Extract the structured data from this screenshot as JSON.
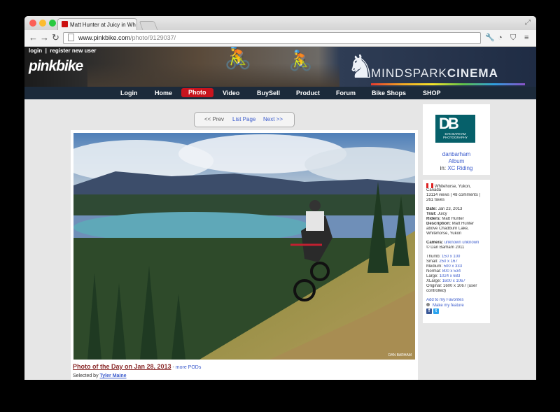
{
  "browser": {
    "tab_title": "Matt Hunter at Juicy in Wh",
    "url_host": "www.pinkbike.com",
    "url_path": "/photo/9129037/",
    "back_glyph": "←",
    "forward_glyph": "→",
    "reload_glyph": "↻",
    "resize_glyph": "⤢",
    "wrench_glyph": "🔧",
    "clock_glyph": "◔",
    "pocket_glyph": "⛉",
    "menu_glyph": "≡"
  },
  "header": {
    "login": "login",
    "separator": "|",
    "register": "register new user",
    "logo_text": "pinkbike",
    "banner_thin": "MINDSPARK",
    "banner_bold": "CINEMA",
    "horse_glyph": "♞",
    "rider_glyph": "🚴"
  },
  "nav": {
    "items": [
      "Login",
      "Home",
      "Photo",
      "Video",
      "BuySell",
      "Product",
      "Forum",
      "Bike Shops",
      "SHOP"
    ],
    "active_index": 2,
    "active_color": "#c8141e"
  },
  "pager": {
    "prev": "<< Prev",
    "list": "List Page",
    "next": "Next >>"
  },
  "photo": {
    "credit": "DAN BARHAM"
  },
  "caption": {
    "potd": "Photo of the Day on Jan 28, 2013",
    "dash": " - ",
    "more": "more PODs",
    "selected_prefix": "Selected by ",
    "selected_by": "Tyler Maine"
  },
  "author": {
    "logo_letters": "DB",
    "logo_text": "DAN BARHAM PHOTOGRAPHY",
    "name": "danbarham",
    "album": "Album",
    "in_prefix": "in: ",
    "category": "XC Riding"
  },
  "details": {
    "location_line1": "Whitehorse, Yukon,",
    "location_line2": "Canada",
    "stats_line1": "13114 views | 48 comments |",
    "stats_line2": "261 faves",
    "date_label": "Date:",
    "date": "Jan 23, 2013",
    "trail_label": "Trail:",
    "trail": "Juicy",
    "riders_label": "Riders:",
    "riders": "Matt Hunter",
    "description_label": "Description:",
    "description_1": "Matt Hunter",
    "description_2": "above Chadburn Lake,",
    "description_3": "Whitehorse, Yukon",
    "camera_label": "Camera:",
    "camera": "unknown unknown",
    "copyright": "© Dan Barham 2011",
    "sizes": [
      {
        "label": "Thumb:",
        "value": "150 x 100"
      },
      {
        "label": "Small:",
        "value": "250 x 167"
      },
      {
        "label": "Medium:",
        "value": "500 x 333"
      },
      {
        "label": "Normal:",
        "value": "800 x 534"
      },
      {
        "label": "Large:",
        "value": "1024 x 683"
      },
      {
        "label": "XLarge:",
        "value": "1600 x 1067"
      }
    ],
    "original_line1": "Original: 1600 x 1067 (user",
    "original_line2": "controlled)",
    "add_favorites": "Add to my Favorites",
    "make_feature": "Make my feature",
    "fb_letter": "f",
    "tw_letter": "t"
  }
}
